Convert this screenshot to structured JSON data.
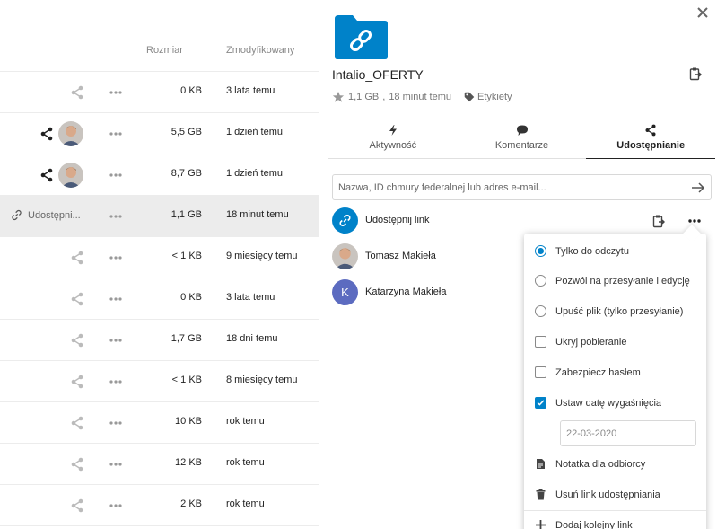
{
  "file_list": {
    "columns": {
      "size": "Rozmiar",
      "modified": "Zmodyfikowany"
    },
    "rows": [
      {
        "size": "0 KB",
        "modified": "3 lata temu",
        "shared": false
      },
      {
        "size": "5,5 GB",
        "modified": "1 dzień temu",
        "shared": true
      },
      {
        "size": "8,7 GB",
        "modified": "1 dzień temu",
        "shared": true
      },
      {
        "size": "1,1 GB",
        "modified": "18 minut temu",
        "shared": "link",
        "share_label": "Udostępni..."
      },
      {
        "size": "< 1 KB",
        "modified": "9 miesięcy temu",
        "shared": false
      },
      {
        "size": "0 KB",
        "modified": "3 lata temu",
        "shared": false
      },
      {
        "size": "1,7 GB",
        "modified": "18 dni temu",
        "shared": false
      },
      {
        "size": "< 1 KB",
        "modified": "8 miesięcy temu",
        "shared": false
      },
      {
        "size": "10 KB",
        "modified": "rok temu",
        "shared": false
      },
      {
        "size": "12 KB",
        "modified": "rok temu",
        "shared": false
      },
      {
        "size": "2 KB",
        "modified": "rok temu",
        "shared": false
      }
    ]
  },
  "sidebar": {
    "title": "Intalio_OFERTY",
    "meta": {
      "size": "1,1 GB",
      "time": "18 minut temu",
      "tags_label": "Etykiety"
    },
    "tabs": [
      {
        "label": "Aktywność",
        "icon": "bolt-icon"
      },
      {
        "label": "Komentarze",
        "icon": "comment-icon"
      },
      {
        "label": "Udostępnianie",
        "icon": "share-icon",
        "active": true
      }
    ],
    "share_input": {
      "placeholder": "Nazwa, ID chmury federalnej lub adres e-mail..."
    },
    "share_link_label": "Udostępnij link",
    "shares": [
      {
        "name": "Tomasz Makieła"
      },
      {
        "name": "Katarzyna Makieła",
        "initial": "K"
      }
    ]
  },
  "menu": {
    "read_only": "Tylko do odczytu",
    "allow_upload_edit": "Pozwól na przesyłanie i edycję",
    "file_drop": "Upuść plik (tylko przesyłanie)",
    "hide_download": "Ukryj pobieranie",
    "password_protect": "Zabezpiecz hasłem",
    "set_expiration": "Ustaw datę wygaśnięcia",
    "expiration_date": "22-03-2020",
    "note": "Notatka dla odbiorcy",
    "unshare": "Usuń link udostępniania",
    "add_link": "Dodaj kolejny link"
  },
  "colors": {
    "accent": "#0082c9",
    "avatar_k": "#5c6bc0"
  }
}
